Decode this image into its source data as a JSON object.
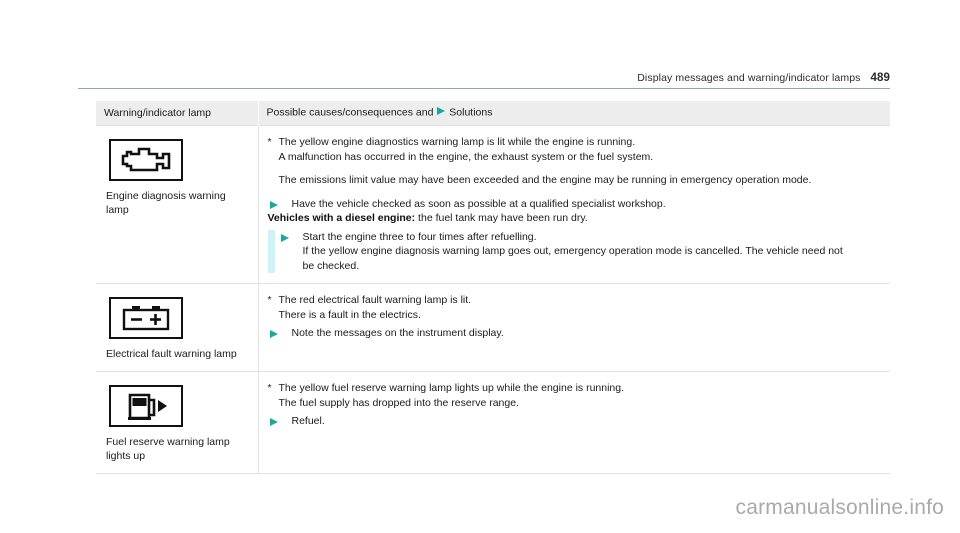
{
  "header": {
    "running_title": "Display messages and warning/indicator lamps",
    "page_number": "489"
  },
  "accent_colors": {
    "arrow_teal": "#17a8a0",
    "marker_bar_cyan": "#ccf3f5",
    "header_row_gray": "#ededed",
    "rule_gray": "#9aa8a5"
  },
  "table": {
    "columns": [
      {
        "label": "Warning/indicator lamp"
      },
      {
        "label_before_icon": "Possible causes/consequences and",
        "icon": "triangle-right-icon",
        "label_after_icon": "Solutions"
      }
    ],
    "rows": [
      {
        "lamp": {
          "icon": "engine-diagnosis-icon",
          "caption": "Engine diagnosis warning lamp"
        },
        "blocks": [
          {
            "type": "star",
            "lines": [
              "The yellow engine diagnostics warning lamp is lit while the engine is running.",
              "A malfunction has occurred in the engine, the exhaust system or the fuel system."
            ]
          },
          {
            "type": "plain",
            "lines": [
              "The emissions limit value may have been exceeded and the engine may be running in emergency operation mode."
            ]
          },
          {
            "type": "action",
            "icon": "triangle-right-icon",
            "lines": [
              "Have the vehicle checked as soon as possible at a qualified specialist workshop."
            ]
          },
          {
            "type": "emphasis",
            "bold_text": "Vehicles with a diesel engine:",
            "rest_text": " the fuel tank may have been run dry."
          },
          {
            "type": "action-marked",
            "icon": "triangle-right-icon",
            "lines": [
              "Start the engine three to four times after refuelling.",
              "If the yellow engine diagnosis warning lamp goes out, emergency operation mode is cancelled. The vehicle need not",
              "be checked."
            ]
          }
        ]
      },
      {
        "lamp": {
          "icon": "battery-icon",
          "caption": "Electrical fault warning lamp"
        },
        "blocks": [
          {
            "type": "star",
            "lines": [
              "The red electrical fault warning lamp is lit.",
              "There is a fault in the electrics."
            ]
          },
          {
            "type": "action",
            "icon": "triangle-right-icon",
            "lines": [
              "Note the messages on the instrument display."
            ]
          }
        ]
      },
      {
        "lamp": {
          "icon": "fuel-pump-icon",
          "caption": "Fuel reserve warning lamp lights up"
        },
        "blocks": [
          {
            "type": "star",
            "lines": [
              "The yellow fuel reserve warning lamp lights up while the engine is running.",
              "The fuel supply has dropped into the reserve range."
            ]
          },
          {
            "type": "action",
            "icon": "triangle-right-icon",
            "lines": [
              "Refuel."
            ]
          }
        ]
      }
    ]
  },
  "watermark": {
    "text": "carmanualsonline.info"
  }
}
